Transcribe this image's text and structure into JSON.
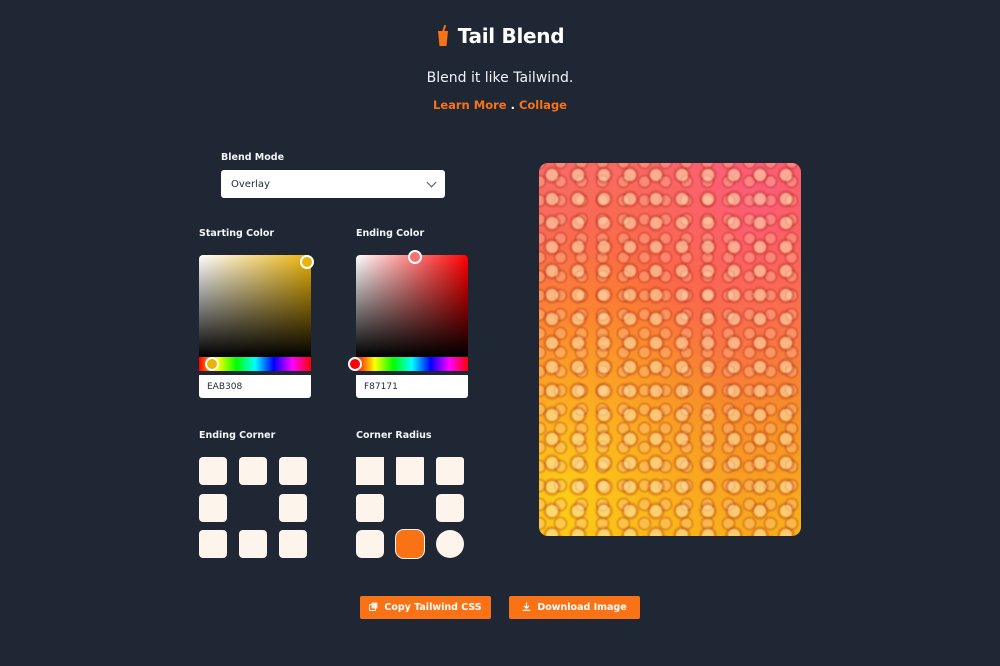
{
  "app": {
    "title": "Tail Blend",
    "tagline": "Blend it like Tailwind.",
    "links": [
      {
        "label": "Learn More"
      },
      {
        "label": "Collage"
      }
    ],
    "link_separator": "."
  },
  "blend_mode": {
    "label": "Blend Mode",
    "value": "Overlay"
  },
  "starting_color": {
    "label": "Starting Color",
    "hex": "EAB308",
    "color": "#eab308"
  },
  "ending_color": {
    "label": "Ending Color",
    "hex": "F87171",
    "color": "#f87171"
  },
  "ending_corner": {
    "label": "Ending Corner",
    "options": [
      "top-left",
      "top",
      "top-right",
      "left",
      "right",
      "bottom-left",
      "bottom",
      "bottom-right"
    ]
  },
  "corner_radius": {
    "label": "Corner Radius",
    "selected": "rounded-lg"
  },
  "actions": {
    "copy_label": "Copy Tailwind CSS",
    "download_label": "Download Image"
  },
  "colors": {
    "accent": "#f97316",
    "background": "#1f2735",
    "tile": "#fdf4ec"
  },
  "icons": {
    "logo": "cup-icon",
    "copy": "copy-icon",
    "download": "download-icon",
    "dropdown": "chevron-down-icon"
  }
}
